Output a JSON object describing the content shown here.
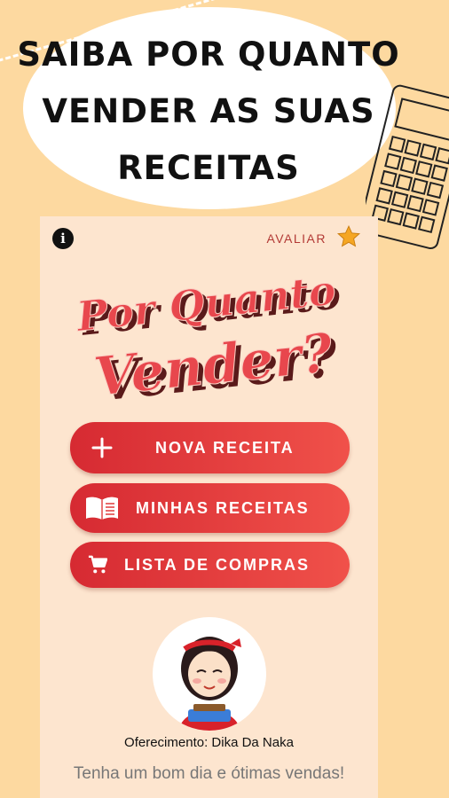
{
  "promo": {
    "headline_line1": "SAIBA POR QUANTO",
    "headline_line2": "VENDER AS SUAS",
    "headline_line3": "RECEITAS"
  },
  "app": {
    "logo_line1": "Por Quanto",
    "logo_line2": "Vender?",
    "rate_label": "AVALIAR",
    "info_icon": "i",
    "buttons": [
      {
        "label": "NOVA RECEITA",
        "icon": "plus-icon"
      },
      {
        "label": "MINHAS RECEITAS",
        "icon": "book-icon"
      },
      {
        "label": "LISTA DE COMPRAS",
        "icon": "cart-icon"
      }
    ],
    "sponsor": "Oferecimento: Dika Da Naka",
    "greeting": "Tenha um bom dia e ótimas vendas!"
  },
  "colors": {
    "background": "#fdd9a0",
    "panel": "#fde5cf",
    "button_red": "#e03a3a",
    "accent_text": "#b33a36",
    "star": "#f5a623"
  }
}
